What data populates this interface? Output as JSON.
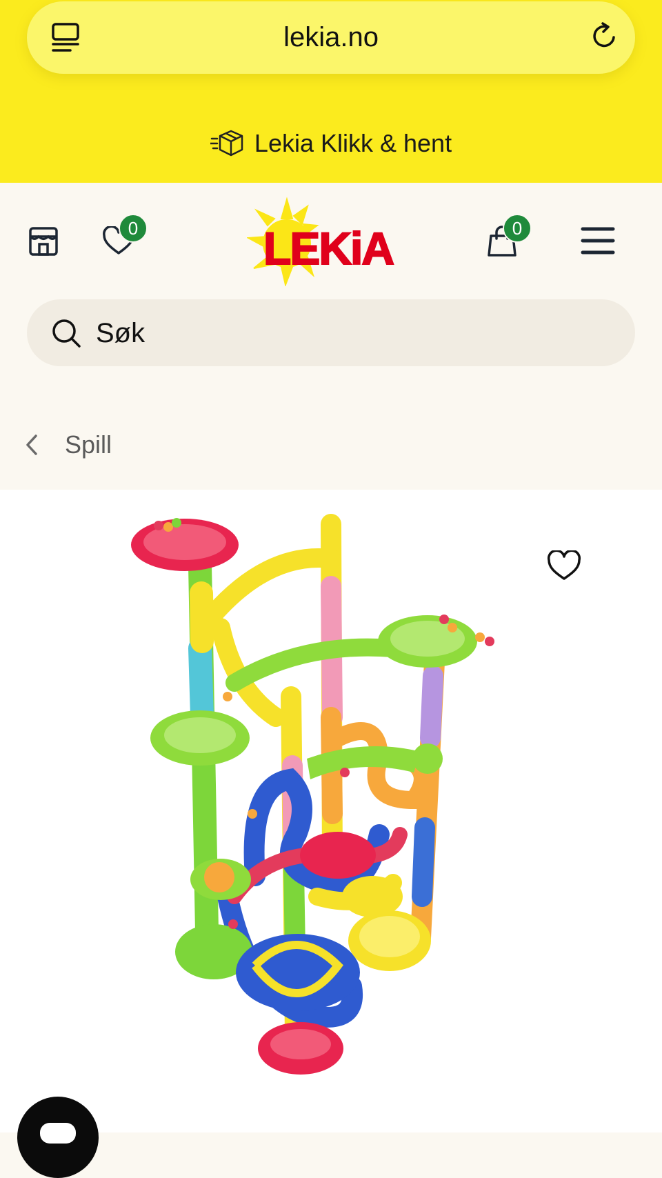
{
  "browser": {
    "url": "lekia.no",
    "icons": {
      "tabs": "tabs-icon",
      "reload": "reload-icon"
    }
  },
  "promo": {
    "text": "Lekia Klikk & hent",
    "icon": "parcel-box-icon"
  },
  "header": {
    "logo_text": "LEKiA",
    "wishlist_count": "0",
    "cart_count": "0",
    "icons": {
      "store": "store-icon",
      "wishlist": "heart-icon",
      "cart": "shopping-bag-icon",
      "menu": "hamburger-menu-icon"
    }
  },
  "search": {
    "placeholder": "Søk"
  },
  "breadcrumb": {
    "label": "Spill"
  },
  "product": {
    "image": "marble-run-toy-image",
    "favorite_icon": "heart-icon"
  },
  "colors": {
    "brand_yellow": "#fbeb1e",
    "logo_red": "#e0001b",
    "badge_green": "#1f8a3b",
    "page_bg": "#fbf8f1"
  }
}
